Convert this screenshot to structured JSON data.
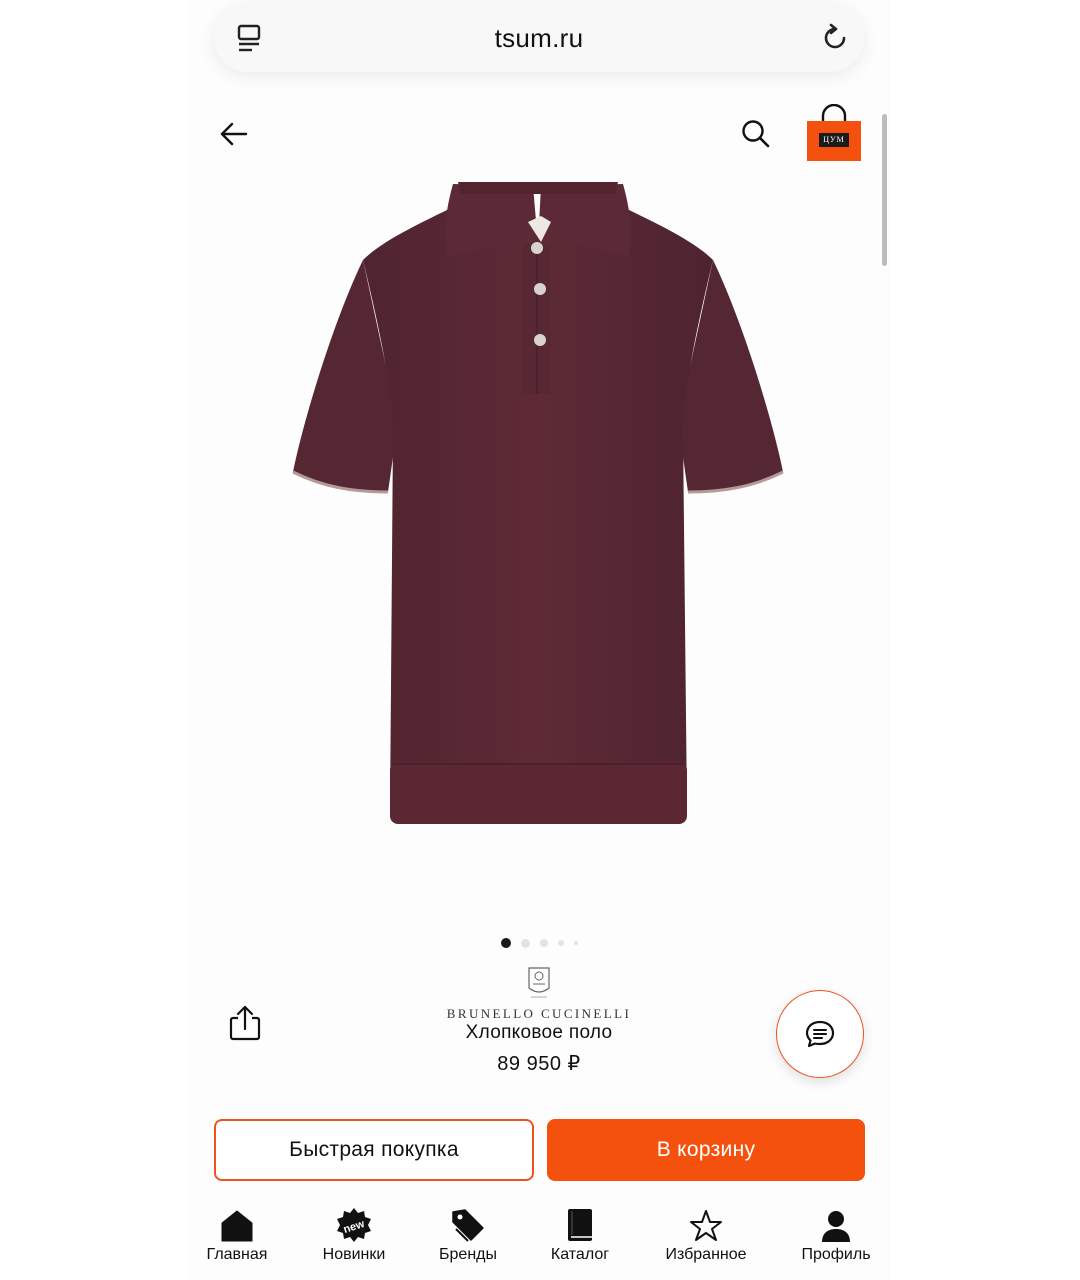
{
  "browser": {
    "url": "tsum.ru"
  },
  "header": {
    "cart_logo_text": "ЦУМ"
  },
  "gallery": {
    "slides_count": 5,
    "active_index": 0
  },
  "product": {
    "brand": "BRUNELLO CUCINELLI",
    "name": "Хлопковое поло",
    "price": "89 950 ₽",
    "color_hex": "#5e2a36"
  },
  "actions": {
    "quick_buy_label": "Быстрая покупка",
    "add_to_cart_label": "В корзину"
  },
  "tabbar": {
    "items": [
      {
        "label": "Главная",
        "icon": "home-icon"
      },
      {
        "label": "Новинки",
        "icon": "new-badge-icon",
        "badge": "new"
      },
      {
        "label": "Бренды",
        "icon": "tag-icon"
      },
      {
        "label": "Каталог",
        "icon": "book-icon"
      },
      {
        "label": "Избранное",
        "icon": "star-icon"
      },
      {
        "label": "Профиль",
        "icon": "user-icon"
      }
    ]
  },
  "colors": {
    "accent": "#f4510f",
    "text": "#111111",
    "background": "#ffffff"
  }
}
